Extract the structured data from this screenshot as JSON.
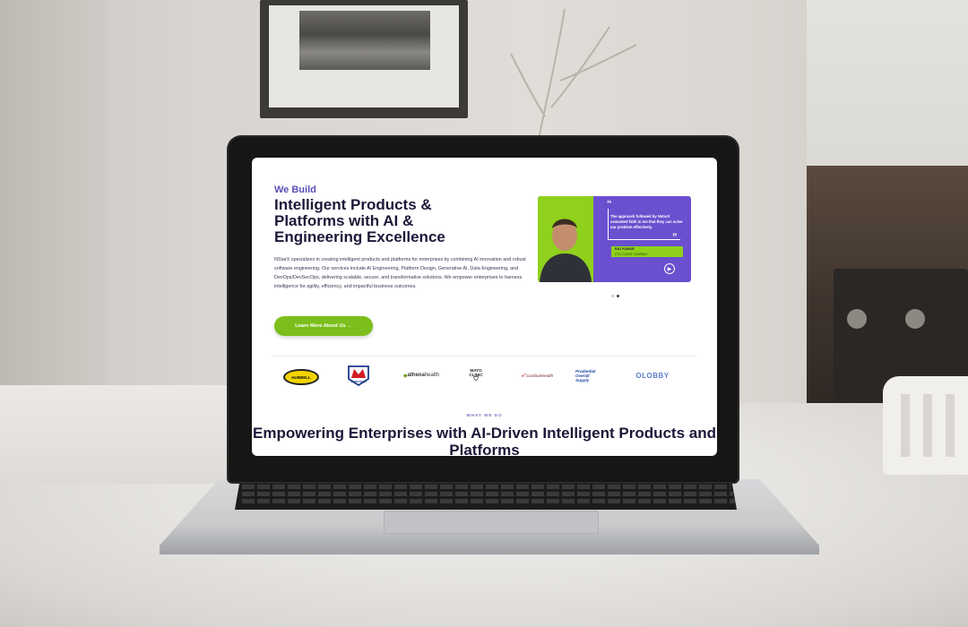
{
  "website": {
    "hero": {
      "eyebrow": "We Build",
      "title": "Intelligent Products & Platforms with AI & Engineering Excellence",
      "body": "NStarX specializes in creating intelligent products and platforms for enterprises by combining AI innovation and robust software engineering. Our services include AI Engineering, Platform Design, Generative AI, Data Engineering, and DevOps/DevSecOps, delivering scalable, secure, and transformative solutions. We empower enterprises to harness intelligence for agility, efficiency, and impactful business outcomes.",
      "cta_label": "Learn More About Us →"
    },
    "testimonial": {
      "quote_open": "“",
      "quote_close": "”",
      "quote": "The approach followed by NstarX cemented faith in me that they can solve our problem effectively.",
      "name": "RAJ KUMAR",
      "role": "CTO, CLIENT COMPANY",
      "play_icon": "play-circle-icon",
      "carousel_active_index": 1,
      "carousel_count": 2
    },
    "logos": {
      "hubbell": "HUBBELL",
      "marathon": "MARATHON",
      "athena_prefix": "athena",
      "athena_suffix": "health",
      "mayo_line1": "MAYO",
      "mayo_line2": "CLINIC",
      "cardinal": "CardinalHealth",
      "prudential_line1": "Prudential",
      "prudential_line2": "Overall",
      "prudential_line3": "Supply",
      "olobby": "OLOBBY"
    },
    "section": {
      "eyebrow": "WHAT WE DO",
      "title": "Empowering Enterprises with AI-Driven Intelligent Products and Platforms"
    },
    "colors": {
      "brand_purple": "#6a4fcf",
      "accent_green": "#7cbf1c",
      "heading_dark": "#1c1838"
    }
  }
}
